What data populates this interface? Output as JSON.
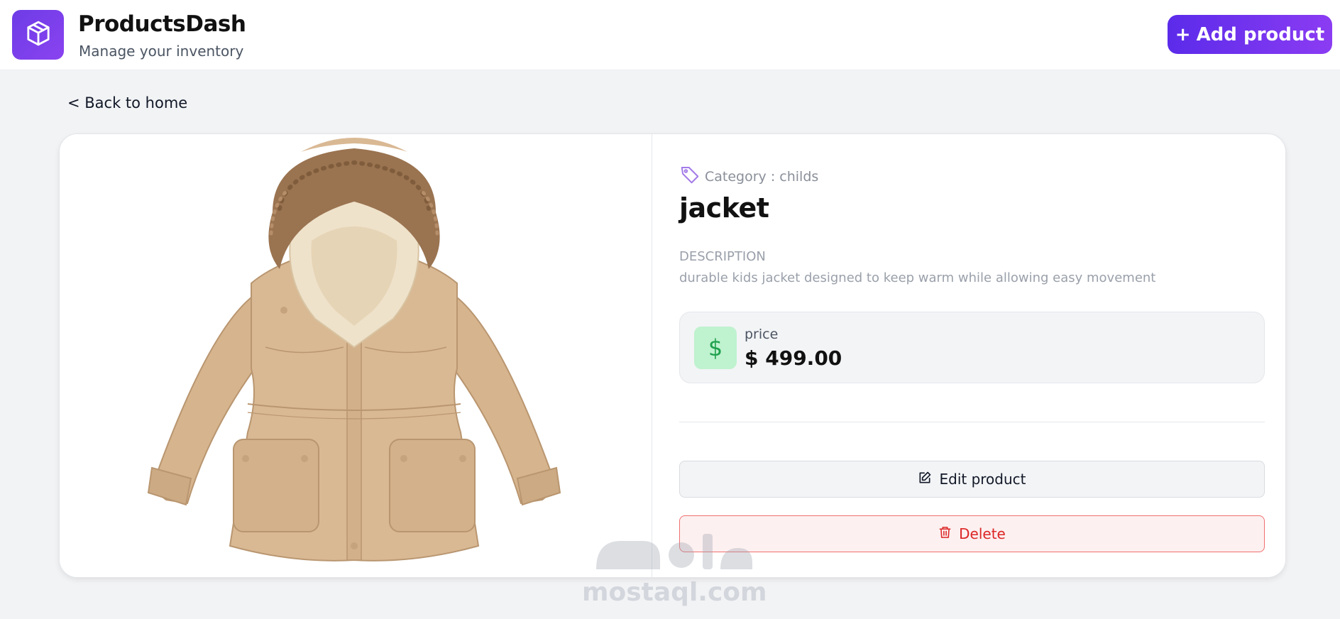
{
  "header": {
    "brand_title": "ProductsDash",
    "brand_subtitle": "Manage your inventory",
    "logo_icon": "box-icon",
    "add_button_label": "Add product",
    "add_button_icon": "plus-icon"
  },
  "nav": {
    "back_label": "< Back to home"
  },
  "product": {
    "image_alt": "jacket",
    "category_icon": "tag-icon",
    "category_text": "Category : childs",
    "name": "jacket",
    "description_label": "DESCRIPTION",
    "description": "durable kids jacket designed to keep warm while allowing easy movement",
    "price_icon": "dollar-icon",
    "price_symbol": "$",
    "price_label": "price",
    "price_value": "$ 499.00"
  },
  "actions": {
    "edit_label": "Edit product",
    "edit_icon": "edit-icon",
    "delete_label": "Delete",
    "delete_icon": "trash-icon"
  },
  "watermark": {
    "text": "mostaql.com"
  },
  "colors": {
    "accent": "#6d3ce6",
    "price_icon_bg": "#bff2cf",
    "delete": "#dc2626"
  }
}
